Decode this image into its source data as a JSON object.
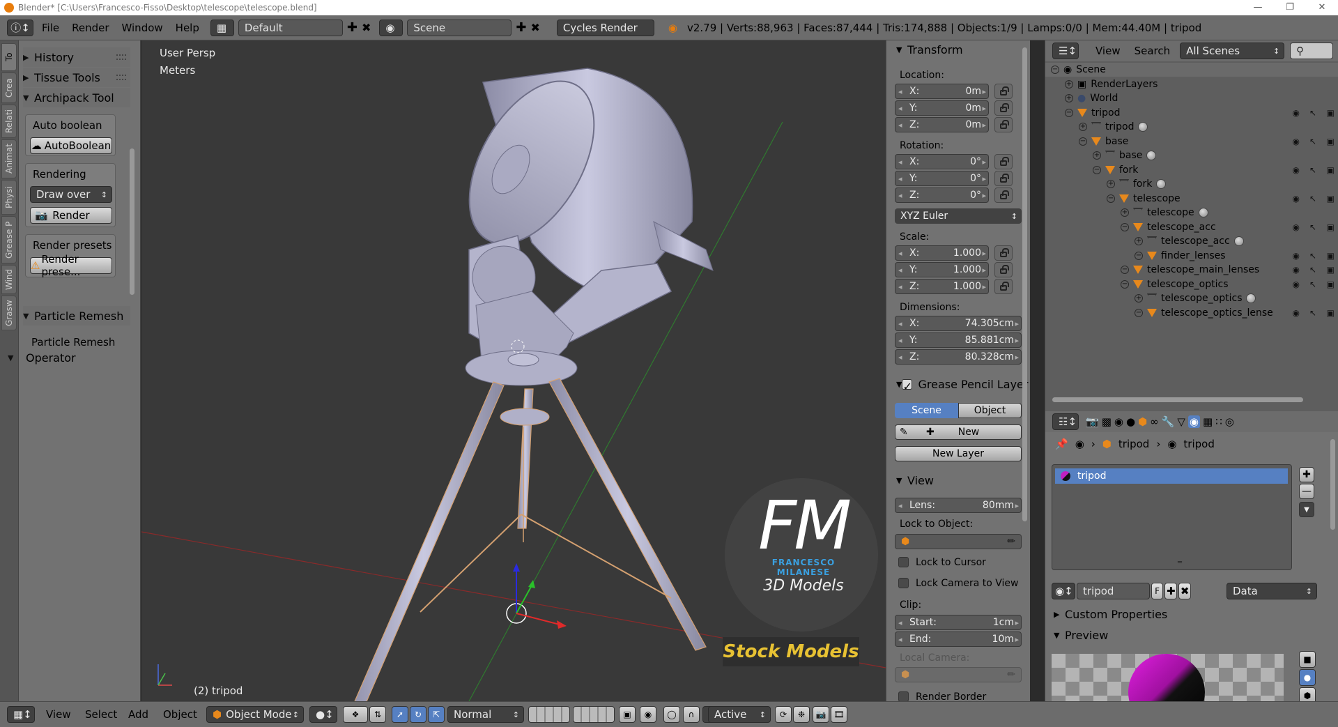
{
  "window": {
    "title": "Blender* [C:\\Users\\Francesco-Fisso\\Desktop\\telescope\\telescope.blend]"
  },
  "top": {
    "menus": [
      "File",
      "Render",
      "Window",
      "Help"
    ],
    "layout": "Default",
    "scene": "Scene",
    "engine": "Cycles Render",
    "stats": "v2.79 | Verts:88,963 | Faces:87,444 | Tris:174,888 | Objects:1/9 | Lamps:0/0 | Mem:44.40M | tripod"
  },
  "tabs": [
    "To",
    "Crea",
    "Relati",
    "Animat",
    "Physi",
    "Grease P",
    "Wind",
    "Grasw"
  ],
  "toolshelf": {
    "history": "History",
    "tissue": "Tissue Tools",
    "archipack": "Archipack Tools",
    "auto_boolean_label": "Auto boolean",
    "auto_boolean_btn": "AutoBoolean",
    "rendering_label": "Rendering",
    "draw_over": "Draw over",
    "render_btn": "Render",
    "render_presets_label": "Render presets",
    "render_presets_btn": "Render prese...",
    "particle_remesh_hdr": "Particle Remesh",
    "particle_remesh_btn": "Particle Remesh",
    "operator": "Operator"
  },
  "viewport": {
    "view_name": "User Persp",
    "units": "Meters",
    "object_label": "(2) tripod",
    "watermark_logo": "FM",
    "watermark_name": "FRANCESCO MILANESE",
    "watermark_sub": "3D Models",
    "stock": "Stock Models"
  },
  "npanel": {
    "transform": "Transform",
    "location": "Location:",
    "loc": [
      {
        "axis": "X:",
        "val": "0m"
      },
      {
        "axis": "Y:",
        "val": "0m"
      },
      {
        "axis": "Z:",
        "val": "0m"
      }
    ],
    "rotation": "Rotation:",
    "rot": [
      {
        "axis": "X:",
        "val": "0°"
      },
      {
        "axis": "Y:",
        "val": "0°"
      },
      {
        "axis": "Z:",
        "val": "0°"
      }
    ],
    "euler": "XYZ Euler",
    "scale": "Scale:",
    "scl": [
      {
        "axis": "X:",
        "val": "1.000"
      },
      {
        "axis": "Y:",
        "val": "1.000"
      },
      {
        "axis": "Z:",
        "val": "1.000"
      }
    ],
    "dimensions": "Dimensions:",
    "dim": [
      {
        "axis": "X:",
        "val": "74.305cm"
      },
      {
        "axis": "Y:",
        "val": "85.881cm"
      },
      {
        "axis": "Z:",
        "val": "80.328cm"
      }
    ],
    "gp_layer": "Grease Pencil Layer",
    "scene_btn": "Scene",
    "object_btn": "Object",
    "new_btn": "New",
    "new_layer": "New Layer",
    "view": "View",
    "lens_label": "Lens:",
    "lens_val": "80mm",
    "lock_to_object": "Lock to Object:",
    "lock_to_cursor": "Lock to Cursor",
    "lock_camera": "Lock Camera to View",
    "clip": "Clip:",
    "clip_start_label": "Start:",
    "clip_start": "1cm",
    "clip_end_label": "End:",
    "clip_end": "10m",
    "local_camera": "Local Camera:",
    "render_border": "Render Border"
  },
  "outliner": {
    "view": "View",
    "search": "Search",
    "filter": "All Scenes",
    "rows": [
      "Scene",
      "RenderLayers",
      "World",
      "tripod",
      "tripod",
      "base",
      "base",
      "fork",
      "fork",
      "telescope",
      "telescope",
      "telescope_acc",
      "telescope_acc",
      "finder_lenses",
      "telescope_main_lenses",
      "telescope_optics",
      "telescope_optics",
      "telescope_optics_lense"
    ]
  },
  "properties": {
    "crumb1": "tripod",
    "crumb2": "tripod",
    "slot": "tripod",
    "mat_name": "tripod",
    "mat_f": "F",
    "link": "Data",
    "custom_props": "Custom Properties",
    "preview": "Preview"
  },
  "bottom": {
    "view": "View",
    "select": "Select",
    "add": "Add",
    "object": "Object",
    "mode": "Object Mode",
    "pivot": "Normal",
    "snap": "Active"
  },
  "colors": {
    "accent_blue": "#5680c2",
    "object_orange": "#e8891c"
  }
}
